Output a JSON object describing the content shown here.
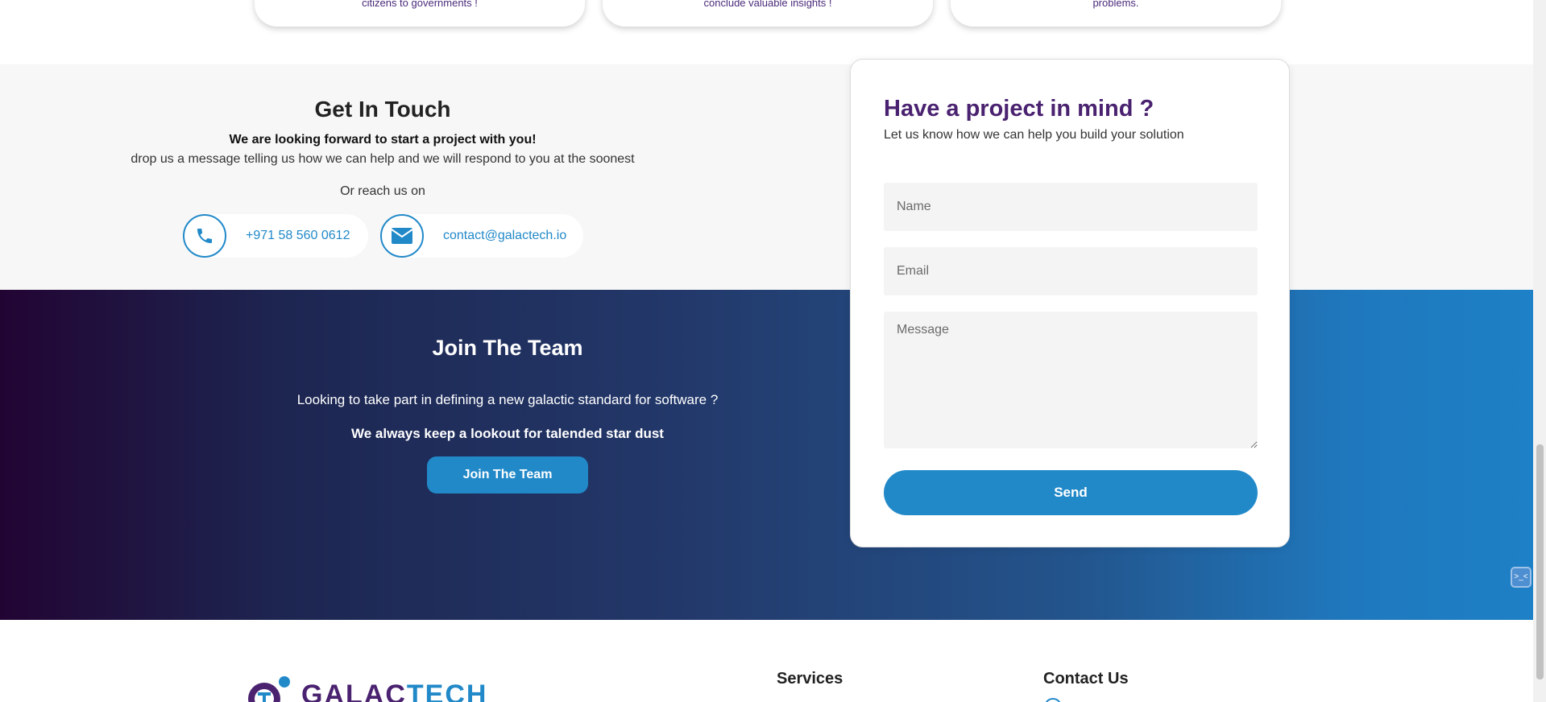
{
  "top_cards": [
    {
      "text": "citizens to governments !"
    },
    {
      "text": "conclude valuable insights !"
    },
    {
      "text": "problems."
    }
  ],
  "touch": {
    "title": "Get In Touch",
    "bold": "We are looking forward to start a project with you!",
    "sub": "drop us a message telling us how we can help and we will respond to you at the soonest",
    "or": "Or reach us on",
    "phone": "+971 58 560 0612",
    "email": "contact@galactech.io"
  },
  "join": {
    "title": "Join The Team",
    "sub": "Looking to take part in defining a new galactic standard for software ?",
    "bold": "We always keep a lookout for talended star dust",
    "button": "Join The Team"
  },
  "form": {
    "title": "Have a project in mind ?",
    "subtitle": "Let us know how we can help you build your solution",
    "name_placeholder": "Name",
    "email_placeholder": "Email",
    "message_placeholder": "Message",
    "send": "Send"
  },
  "widget": {
    "label": ">_<"
  },
  "footer": {
    "logo_a": "GALAC",
    "logo_b": "TECH",
    "services": "Services",
    "contact": "Contact Us"
  },
  "colors": {
    "accent": "#2289c9",
    "brand_purple": "#4a2270"
  }
}
